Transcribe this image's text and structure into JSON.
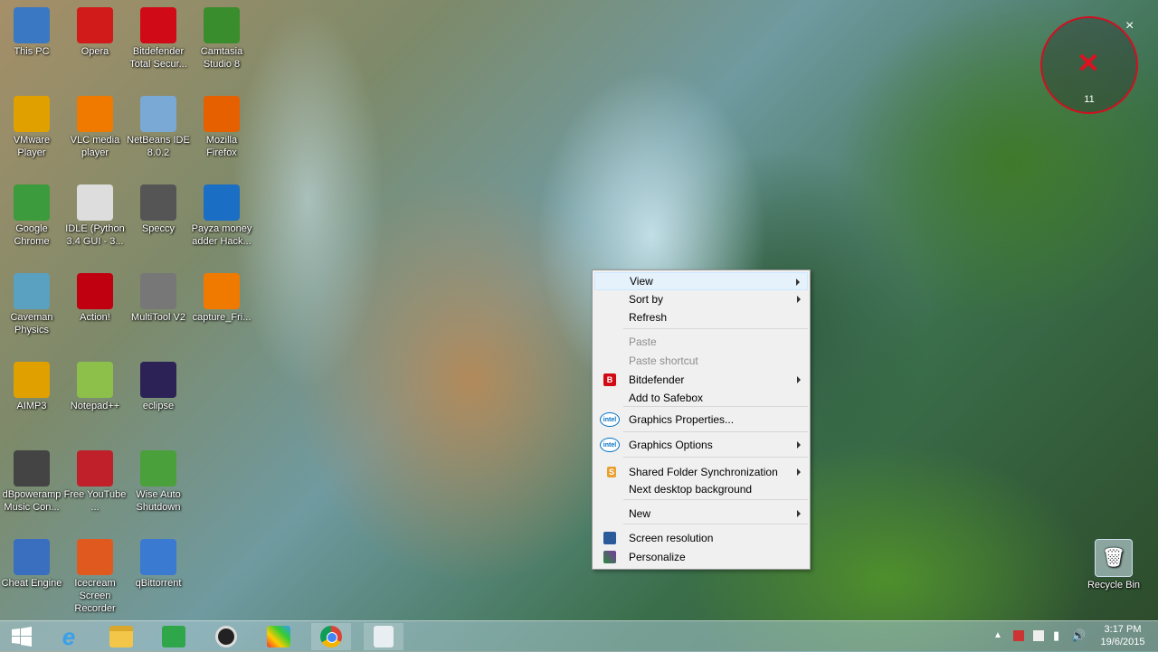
{
  "desktop_icons": [
    {
      "label": "This PC",
      "icon": "pc-icon",
      "color": "#3b78c4"
    },
    {
      "label": "Opera",
      "icon": "opera-icon",
      "color": "#d11a1a"
    },
    {
      "label": "Bitdefender Total Secur...",
      "icon": "bitdefender-icon",
      "color": "#d10a17"
    },
    {
      "label": "Camtasia Studio 8",
      "icon": "camtasia-icon",
      "color": "#3a8d2c"
    },
    {
      "label": "VMware Player",
      "icon": "vmware-icon",
      "color": "#e0a000"
    },
    {
      "label": "VLC media player",
      "icon": "vlc-icon",
      "color": "#f07a00"
    },
    {
      "label": "NetBeans IDE 8.0.2",
      "icon": "netbeans-icon",
      "color": "#7aa9d6"
    },
    {
      "label": "Mozilla Firefox",
      "icon": "firefox-icon",
      "color": "#e66000"
    },
    {
      "label": "Google Chrome",
      "icon": "chrome-icon",
      "color": "#3c9b3c"
    },
    {
      "label": "IDLE (Python 3.4 GUI - 3...",
      "icon": "python-icon",
      "color": "#dddddd"
    },
    {
      "label": "Speccy",
      "icon": "speccy-icon",
      "color": "#555555"
    },
    {
      "label": "Payza money adder Hack...",
      "icon": "download-icon",
      "color": "#1a6fc4"
    },
    {
      "label": "Caveman Physics",
      "icon": "caveman-icon",
      "color": "#5aa0c0"
    },
    {
      "label": "Action!",
      "icon": "action-icon",
      "color": "#c00010"
    },
    {
      "label": "MultiTool V2",
      "icon": "gear-icon",
      "color": "#777777"
    },
    {
      "label": "capture_Fri...",
      "icon": "vlc-icon",
      "color": "#f07a00"
    },
    {
      "label": "AIMP3",
      "icon": "aimp-icon",
      "color": "#e0a000"
    },
    {
      "label": "Notepad++",
      "icon": "notepad-icon",
      "color": "#8cc04a"
    },
    {
      "label": "eclipse",
      "icon": "eclipse-icon",
      "color": "#2c2255"
    },
    {
      "label": "dBpoweramp Music Con...",
      "icon": "speaker-icon",
      "color": "#444444"
    },
    {
      "label": "Free YouTube ...",
      "icon": "tv-icon",
      "color": "#c0202a"
    },
    {
      "label": "Wise Auto Shutdown",
      "icon": "clock-icon",
      "color": "#4aa03a"
    },
    {
      "label": "Cheat Engine",
      "icon": "cheat-engine-icon",
      "color": "#3a6fc0"
    },
    {
      "label": "Icecream Screen Recorder",
      "icon": "icecream-icon",
      "color": "#e05a20"
    },
    {
      "label": "qBittorrent",
      "icon": "qbittorrent-icon",
      "color": "#3a7ad0"
    }
  ],
  "recycle_bin": {
    "label": "Recycle Bin"
  },
  "context_menu": {
    "items": [
      {
        "label": "View",
        "submenu": true,
        "disabled": false
      },
      {
        "label": "Sort by",
        "submenu": true,
        "disabled": false
      },
      {
        "label": "Refresh",
        "submenu": false,
        "disabled": false
      },
      {
        "label": "Paste",
        "submenu": false,
        "disabled": true
      },
      {
        "label": "Paste shortcut",
        "submenu": false,
        "disabled": true
      },
      {
        "label": "Bitdefender",
        "submenu": true,
        "disabled": false,
        "icon": "bitdefender-icon"
      },
      {
        "label": "Add to Safebox",
        "submenu": false,
        "disabled": false
      },
      {
        "label": "Graphics Properties...",
        "submenu": false,
        "disabled": false,
        "icon": "intel-icon"
      },
      {
        "label": "Graphics Options",
        "submenu": true,
        "disabled": false,
        "icon": "intel-icon"
      },
      {
        "label": "Shared Folder Synchronization",
        "submenu": true,
        "disabled": false,
        "icon": "sync-icon"
      },
      {
        "label": "Next desktop background",
        "submenu": false,
        "disabled": false
      },
      {
        "label": "New",
        "submenu": true,
        "disabled": false
      },
      {
        "label": "Screen resolution",
        "submenu": false,
        "disabled": false,
        "icon": "display-icon"
      },
      {
        "label": "Personalize",
        "submenu": false,
        "disabled": false,
        "icon": "personalize-icon"
      }
    ]
  },
  "recorder_overlay": {
    "count": "11",
    "close": "×"
  },
  "taskbar": {
    "apps": [
      "start-icon",
      "ie-icon",
      "explorer-icon",
      "store-icon",
      "media-icon",
      "paint-icon",
      "chrome-icon",
      "file-icon"
    ],
    "clock_time": "3:17 PM",
    "clock_date": "19/6/2015"
  },
  "colors": {
    "menu_bg": "#f0f0f0",
    "menu_hover": "#e5f1fb",
    "bitdefender_red": "#d10a17",
    "intel_blue": "#0071c5"
  }
}
